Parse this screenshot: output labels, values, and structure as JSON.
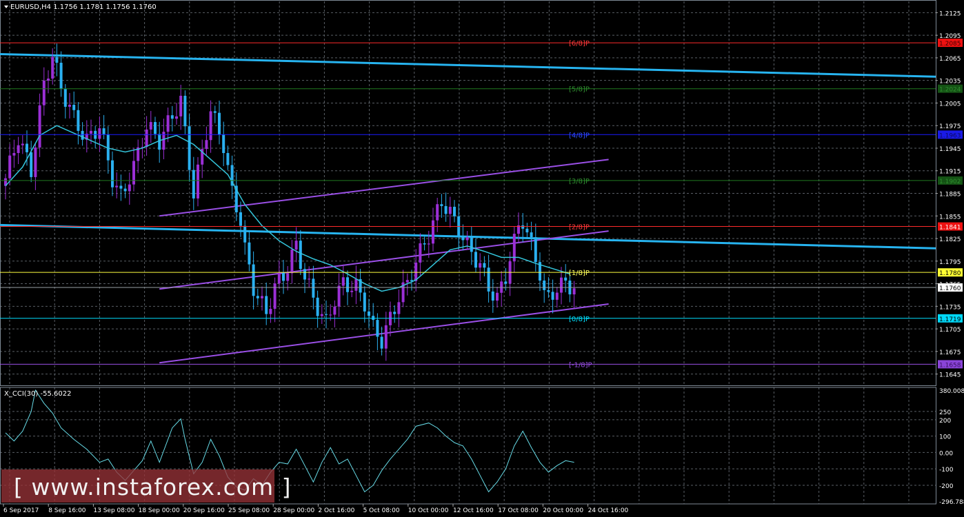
{
  "colors": {
    "background": "#000000",
    "grid": "#5a5f66",
    "candle_up": "#9b2fd6",
    "candle_down": "#2ab0f0",
    "moving_average": "#34c6dc",
    "trend_line": "#27b4f0",
    "channel_line": "#9a4fe6",
    "cci_line": "#67dce8"
  },
  "chart_data": [
    {
      "type": "candlestick",
      "title": "EURUSD,H4  1.1756 1.1781 1.1756 1.1760",
      "price_scale": {
        "range": [
          1.163,
          1.214
        ],
        "ticks": [
          "1.2125",
          "1.2095",
          "1.2065",
          "1.2035",
          "1.2005",
          "1.1975",
          "1.1945",
          "1.1915",
          "1.1885",
          "1.1855",
          "1.1825",
          "1.1795",
          "1.1765",
          "1.1735",
          "1.1705",
          "1.1675",
          "1.1645"
        ]
      },
      "time_labels": [
        "6 Sep 2017",
        "8 Sep 16:00",
        "13 Sep 08:00",
        "18 Sep 00:00",
        "20 Sep 16:00",
        "25 Sep 08:00",
        "28 Sep 00:00",
        "2 Oct 16:00",
        "5 Oct 08:00",
        "10 Oct 00:00",
        "12 Oct 16:00",
        "17 Oct 08:00",
        "20 Oct 00:00",
        "24 Oct 16:00"
      ],
      "close_path": [
        [
          0,
          1.1905
        ],
        [
          3,
          1.196
        ],
        [
          6,
          1.1915
        ],
        [
          9,
          1.203
        ],
        [
          11,
          1.2068
        ],
        [
          13,
          1.2025
        ],
        [
          16,
          1.1985
        ],
        [
          19,
          1.1955
        ],
        [
          22,
          1.1975
        ],
        [
          25,
          1.1905
        ],
        [
          27,
          1.188
        ],
        [
          30,
          1.192
        ],
        [
          33,
          1.1975
        ],
        [
          36,
          1.1955
        ],
        [
          39,
          1.1988
        ],
        [
          41,
          1.2008
        ],
        [
          42,
          1.1965
        ],
        [
          44,
          1.1885
        ],
        [
          46,
          1.194
        ],
        [
          48,
          1.1995
        ],
        [
          51,
          1.195
        ],
        [
          53,
          1.1885
        ],
        [
          55,
          1.185
        ],
        [
          56,
          1.181
        ],
        [
          58,
          1.176
        ],
        [
          61,
          1.1725
        ],
        [
          63,
          1.1762
        ],
        [
          65,
          1.1775
        ],
        [
          68,
          1.1815
        ],
        [
          70,
          1.1775
        ],
        [
          72,
          1.1745
        ],
        [
          75,
          1.1712
        ],
        [
          77,
          1.1745
        ],
        [
          79,
          1.1765
        ],
        [
          82,
          1.176
        ],
        [
          84,
          1.174
        ],
        [
          86,
          1.1705
        ],
        [
          88,
          1.169
        ],
        [
          90,
          1.1718
        ],
        [
          92,
          1.1748
        ],
        [
          94,
          1.1765
        ],
        [
          96,
          1.1795
        ],
        [
          99,
          1.183
        ],
        [
          101,
          1.186
        ],
        [
          102,
          1.1875
        ],
        [
          104,
          1.1858
        ],
        [
          106,
          1.1838
        ],
        [
          108,
          1.1815
        ],
        [
          111,
          1.179
        ],
        [
          113,
          1.176
        ],
        [
          115,
          1.1745
        ],
        [
          117,
          1.1775
        ],
        [
          118,
          1.18
        ],
        [
          120,
          1.184
        ],
        [
          121,
          1.185
        ],
        [
          123,
          1.1815
        ],
        [
          125,
          1.178
        ],
        [
          126,
          1.175
        ],
        [
          127,
          1.1745
        ],
        [
          129,
          1.176
        ],
        [
          131,
          1.1765
        ],
        [
          133,
          1.176
        ]
      ],
      "moving_average_path": [
        [
          0,
          1.1895
        ],
        [
          4,
          1.192
        ],
        [
          8,
          1.1962
        ],
        [
          12,
          1.1975
        ],
        [
          16,
          1.1965
        ],
        [
          20,
          1.1955
        ],
        [
          24,
          1.1945
        ],
        [
          28,
          1.194
        ],
        [
          32,
          1.1945
        ],
        [
          36,
          1.1955
        ],
        [
          40,
          1.1962
        ],
        [
          44,
          1.195
        ],
        [
          48,
          1.193
        ],
        [
          52,
          1.191
        ],
        [
          56,
          1.187
        ],
        [
          60,
          1.1842
        ],
        [
          64,
          1.1822
        ],
        [
          68,
          1.1808
        ],
        [
          72,
          1.1798
        ],
        [
          76,
          1.179
        ],
        [
          80,
          1.1778
        ],
        [
          84,
          1.1765
        ],
        [
          88,
          1.1755
        ],
        [
          92,
          1.176
        ],
        [
          96,
          1.177
        ],
        [
          100,
          1.179
        ],
        [
          104,
          1.181
        ],
        [
          108,
          1.1815
        ],
        [
          112,
          1.1808
        ],
        [
          116,
          1.18
        ],
        [
          120,
          1.18
        ],
        [
          124,
          1.1792
        ],
        [
          128,
          1.1785
        ],
        [
          132,
          1.1778
        ]
      ],
      "trend_lines": [
        {
          "kind": "trend",
          "points": [
            [
              0,
              1.207
            ],
            [
              133,
              1.204
            ]
          ]
        },
        {
          "kind": "trend",
          "points": [
            [
              0,
              1.1843
            ],
            [
              133,
              1.1812
            ]
          ]
        },
        {
          "kind": "channel",
          "points": [
            [
              36,
              1.1855
            ],
            [
              133,
              1.193
            ]
          ]
        },
        {
          "kind": "channel",
          "points": [
            [
              36,
              1.1758
            ],
            [
              133,
              1.1835
            ]
          ]
        },
        {
          "kind": "channel",
          "points": [
            [
              36,
              1.166
            ],
            [
              133,
              1.1738
            ]
          ]
        }
      ],
      "levels": [
        {
          "label": "[6/8]P",
          "price": 1.2085,
          "price_label": "1.2085",
          "color": "#ff2a2a",
          "label_color": "#ff3c3c",
          "tag_bg": "#ee1111",
          "tag_text": "#3a0000"
        },
        {
          "label": "[5/8]P",
          "price": 1.2024,
          "price_label": "1.2024",
          "color": "#1f7a1f",
          "label_color": "#2f8f2f",
          "tag_bg": "#145214",
          "tag_text": "#2f8f2f"
        },
        {
          "label": "[4/8]P",
          "price": 1.1963,
          "price_label": "1.1963",
          "color": "#1a1aff",
          "label_color": "#2f4fff",
          "tag_bg": "#1a1ae6",
          "tag_text": "#0a0a60"
        },
        {
          "label": "[3/8]P",
          "price": 1.1902,
          "price_label": "1.1902",
          "color": "#1f7a1f",
          "label_color": "#2f8f2f",
          "tag_bg": "#145214",
          "tag_text": "#2f8f2f"
        },
        {
          "label": "[2/8]P",
          "price": 1.1841,
          "price_label": "1.1841",
          "color": "#ff2a2a",
          "label_color": "#ff3c3c",
          "tag_bg": "#ee1111",
          "tag_text": "#ffffff"
        },
        {
          "label": "[1/8]P",
          "price": 1.178,
          "price_label": "1.1780",
          "color": "#ffff40",
          "label_color": "#ffff60",
          "tag_bg": "#ffff33",
          "tag_text": "#000000"
        },
        {
          "label": "[0/8]P",
          "price": 1.1719,
          "price_label": "1.1719",
          "color": "#00e0ff",
          "label_color": "#00e0ff",
          "tag_bg": "#00d8f8",
          "tag_text": "#000000"
        },
        {
          "label": "[-1/8]P",
          "price": 1.1658,
          "price_label": "1.1658",
          "color": "#9a4fe6",
          "label_color": "#9a4fe6",
          "tag_bg": "#8a44d8",
          "tag_text": "#3a1060"
        }
      ],
      "current_price": {
        "price": 1.176,
        "label": "1.1760"
      }
    },
    {
      "type": "line",
      "title": "X_CCI(30) -55.6022",
      "range": [
        -296.788,
        380.0085
      ],
      "tick_labels": [
        {
          "label": "380.0085",
          "value": 380.0085
        },
        {
          "label": "250",
          "value": 250
        },
        {
          "label": "200",
          "value": 200
        },
        {
          "label": "100",
          "value": 100
        },
        {
          "label": "0.00",
          "value": 0
        },
        {
          "label": "-100",
          "value": -100
        },
        {
          "label": "-200",
          "value": -200
        },
        {
          "label": "-296.788",
          "value": -296.788
        }
      ],
      "series": [
        {
          "values": [
            [
              0,
              120
            ],
            [
              2,
              70
            ],
            [
              4,
              130
            ],
            [
              6,
              250
            ],
            [
              7,
              380
            ],
            [
              9,
              300
            ],
            [
              11,
              240
            ],
            [
              13,
              150
            ],
            [
              16,
              80
            ],
            [
              19,
              20
            ],
            [
              22,
              -60
            ],
            [
              24,
              -40
            ],
            [
              26,
              -120
            ],
            [
              28,
              -170
            ],
            [
              30,
              -110
            ],
            [
              32,
              -50
            ],
            [
              34,
              70
            ],
            [
              36,
              -60
            ],
            [
              39,
              150
            ],
            [
              41,
              205
            ],
            [
              42,
              80
            ],
            [
              44,
              -130
            ],
            [
              46,
              -60
            ],
            [
              48,
              80
            ],
            [
              50,
              -20
            ],
            [
              52,
              -150
            ],
            [
              54,
              -210
            ],
            [
              56,
              -230
            ],
            [
              58,
              -160
            ],
            [
              60,
              -200
            ],
            [
              62,
              -120
            ],
            [
              64,
              -60
            ],
            [
              66,
              -70
            ],
            [
              68,
              20
            ],
            [
              70,
              -80
            ],
            [
              72,
              -180
            ],
            [
              74,
              -60
            ],
            [
              76,
              30
            ],
            [
              78,
              -70
            ],
            [
              80,
              -40
            ],
            [
              82,
              -140
            ],
            [
              84,
              -240
            ],
            [
              86,
              -200
            ],
            [
              88,
              -110
            ],
            [
              90,
              -40
            ],
            [
              92,
              20
            ],
            [
              94,
              80
            ],
            [
              96,
              160
            ],
            [
              99,
              180
            ],
            [
              101,
              150
            ],
            [
              103,
              100
            ],
            [
              105,
              60
            ],
            [
              107,
              40
            ],
            [
              109,
              -40
            ],
            [
              111,
              -140
            ],
            [
              113,
              -240
            ],
            [
              115,
              -180
            ],
            [
              117,
              -100
            ],
            [
              119,
              40
            ],
            [
              121,
              130
            ],
            [
              123,
              30
            ],
            [
              125,
              -60
            ],
            [
              127,
              -120
            ],
            [
              129,
              -80
            ],
            [
              131,
              -50
            ],
            [
              133,
              -60
            ]
          ]
        }
      ]
    }
  ],
  "watermark": {
    "text": "[ www.instaforex.com ]"
  }
}
